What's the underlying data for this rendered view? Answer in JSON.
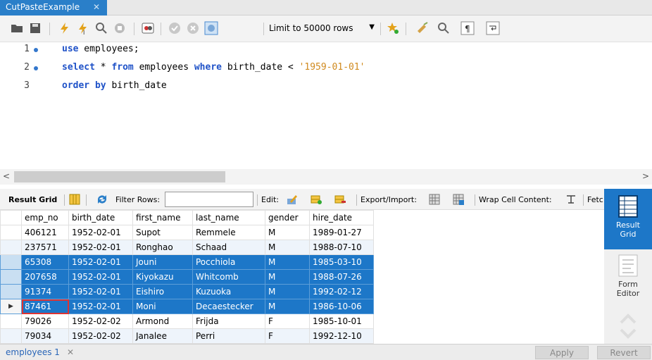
{
  "tab": {
    "title": "CutPasteExample"
  },
  "toolbar": {
    "limit_label": "Limit to 50000 rows"
  },
  "editor": {
    "lines": [
      {
        "num": "1",
        "has_dot": true
      },
      {
        "num": "2",
        "has_dot": true
      },
      {
        "num": "3",
        "has_dot": false
      }
    ],
    "line1": {
      "kw1": "use",
      "rest": " employees;"
    },
    "line2": {
      "kw1": "select",
      "t1": " * ",
      "kw2": "from",
      "t2": " employees ",
      "kw3": "where",
      "t3": " birth_date < ",
      "str": "'1959-01-01'"
    },
    "line3": {
      "kw1": "order by",
      "t1": " birth_date"
    }
  },
  "result_toolbar": {
    "result_grid": "Result Grid",
    "filter_rows": "Filter Rows:",
    "edit": "Edit:",
    "export_import": "Export/Import:",
    "wrap_cell": "Wrap Cell Content:",
    "fetch": "Fetc"
  },
  "grid": {
    "columns": [
      "emp_no",
      "birth_date",
      "first_name",
      "last_name",
      "gender",
      "hire_date"
    ],
    "rows": [
      [
        "406121",
        "1952-02-01",
        "Supot",
        "Remmele",
        "M",
        "1989-01-27"
      ],
      [
        "237571",
        "1952-02-01",
        "Ronghao",
        "Schaad",
        "M",
        "1988-07-10"
      ],
      [
        "65308",
        "1952-02-01",
        "Jouni",
        "Pocchiola",
        "M",
        "1985-03-10"
      ],
      [
        "207658",
        "1952-02-01",
        "Kiyokazu",
        "Whitcomb",
        "M",
        "1988-07-26"
      ],
      [
        "91374",
        "1952-02-01",
        "Eishiro",
        "Kuzuoka",
        "M",
        "1992-02-12"
      ],
      [
        "87461",
        "1952-02-01",
        "Moni",
        "Decaestecker",
        "M",
        "1986-10-06"
      ],
      [
        "79026",
        "1952-02-02",
        "Armond",
        "Frijda",
        "F",
        "1985-10-01"
      ],
      [
        "79034",
        "1952-02-02",
        "Janalee",
        "Perri",
        "F",
        "1992-12-10"
      ]
    ],
    "selected_rows": [
      2,
      3,
      4,
      5
    ],
    "current_row": 5
  },
  "side_panel": {
    "result_grid": [
      "Result",
      "Grid"
    ],
    "form_editor": [
      "Form",
      "Editor"
    ]
  },
  "bottom": {
    "tab_label": "employees 1",
    "apply": "Apply",
    "revert": "Revert"
  },
  "colors": {
    "accent": "#1d77c8",
    "tab": "#2a7fc9",
    "keyword": "#1f52c8",
    "string": "#d08a1e"
  }
}
